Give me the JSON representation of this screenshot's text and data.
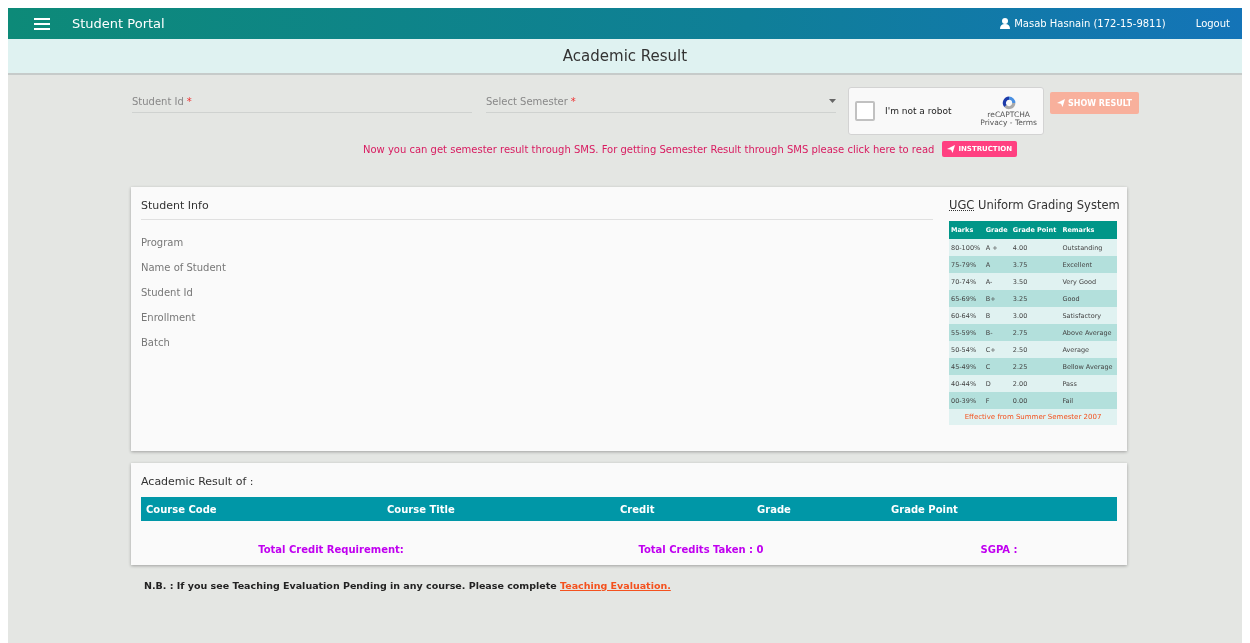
{
  "navbar": {
    "title": "Student Portal",
    "user": "Masab Hasnain (172-15-9811)",
    "logout": "Logout"
  },
  "page_title": "Academic Result",
  "form": {
    "student_id": {
      "placeholder": "Student Id",
      "required_mark": "*"
    },
    "semester": {
      "placeholder": "Select Semester",
      "required_mark": "*"
    },
    "captcha": {
      "label": "I'm not a robot",
      "checked": false,
      "brand": "reCAPTCHA",
      "links": "Privacy - Terms"
    },
    "show_button": "SHOW RESULT"
  },
  "sms_notice": {
    "text": "Now you can get semester result through SMS. For getting Semester Result through SMS please click here to read",
    "button": "INSTRUCTION"
  },
  "student_info": {
    "title": "Student Info",
    "fields": [
      "Program",
      "Name of Student",
      "Student Id",
      "Enrollment",
      "Batch"
    ]
  },
  "grading": {
    "abbr": "UGC",
    "title": "Uniform Grading System",
    "columns": [
      "Marks",
      "Grade",
      "Grade Point",
      "Remarks"
    ],
    "rows": [
      [
        "80-100%",
        "A +",
        "4.00",
        "Outstanding"
      ],
      [
        "75-79%",
        "A",
        "3.75",
        "Excellent"
      ],
      [
        "70-74%",
        "A-",
        "3.50",
        "Very Good"
      ],
      [
        "65-69%",
        "B+",
        "3.25",
        "Good"
      ],
      [
        "60-64%",
        "B",
        "3.00",
        "Satisfactory"
      ],
      [
        "55-59%",
        "B-",
        "2.75",
        "Above Average"
      ],
      [
        "50-54%",
        "C+",
        "2.50",
        "Average"
      ],
      [
        "45-49%",
        "C",
        "2.25",
        "Bellow Average"
      ],
      [
        "40-44%",
        "D",
        "2.00",
        "Pass"
      ],
      [
        "00-39%",
        "F",
        "0.00",
        "Fail"
      ]
    ],
    "footer": "Effective from Summer Semester 2007"
  },
  "result": {
    "title": "Academic Result of :",
    "columns": [
      "Course Code",
      "Course Title",
      "Credit",
      "Grade",
      "Grade Point"
    ],
    "totals": [
      "Total Credit Requirement:",
      "Total Credits Taken : 0",
      "SGPA :"
    ]
  },
  "note": {
    "text": "N.B. : If you see Teaching Evaluation Pending in any course. Please complete",
    "link": "Teaching Evaluation."
  }
}
